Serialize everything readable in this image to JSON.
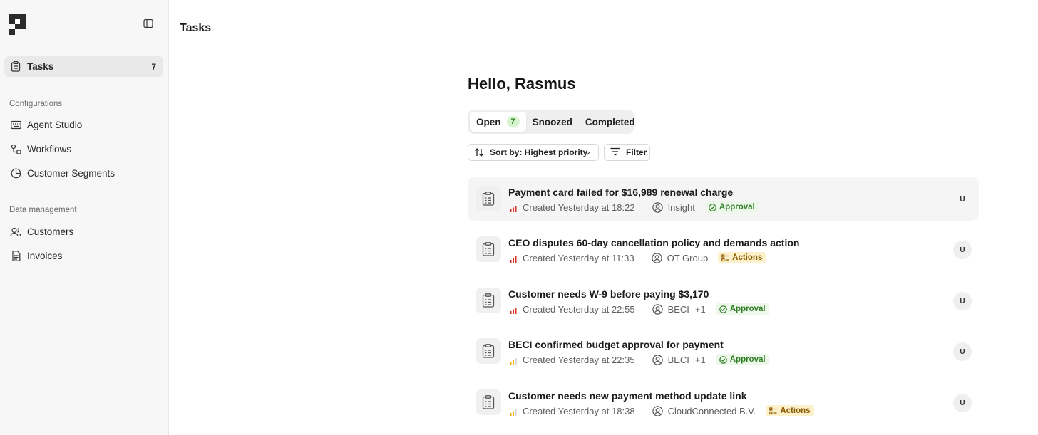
{
  "sidebar": {
    "nav": [
      {
        "label": "Tasks",
        "icon": "clipboard-icon",
        "count": "7",
        "active": true
      }
    ],
    "sections": [
      {
        "title": "Configurations",
        "items": [
          {
            "label": "Agent Studio",
            "icon": "keyboard-icon"
          },
          {
            "label": "Workflows",
            "icon": "workflow-icon"
          },
          {
            "label": "Customer Segments",
            "icon": "pie-chart-icon"
          }
        ]
      },
      {
        "title": "Data management",
        "items": [
          {
            "label": "Customers",
            "icon": "users-icon"
          },
          {
            "label": "Invoices",
            "icon": "file-text-icon"
          }
        ]
      }
    ]
  },
  "header": {
    "title": "Tasks"
  },
  "main": {
    "greeting": "Hello, Rasmus",
    "tabs": [
      {
        "label": "Open",
        "badge": "7",
        "active": true
      },
      {
        "label": "Snoozed"
      },
      {
        "label": "Completed"
      }
    ],
    "sort_label": "Sort by: Highest priority",
    "filter_label": "Filter",
    "tasks": [
      {
        "title": "Payment card failed for $16,989 renewal charge",
        "created": "Created Yesterday at 18:22",
        "customer": "Insight",
        "more": "",
        "tag": "Approval",
        "tag_type": "approval",
        "priority": "high",
        "assignee": "U"
      },
      {
        "title": "CEO disputes 60-day cancellation policy and demands action",
        "created": "Created Yesterday at 11:33",
        "customer": "OT Group",
        "more": "",
        "tag": "Actions",
        "tag_type": "actions",
        "priority": "high",
        "assignee": "U"
      },
      {
        "title": "Customer needs W-9 before paying $3,170",
        "created": "Created Yesterday at 22:55",
        "customer": "BECI",
        "more": "+1",
        "tag": "Approval",
        "tag_type": "approval",
        "priority": "high",
        "assignee": "U"
      },
      {
        "title": "BECI confirmed budget approval for payment",
        "created": "Created Yesterday at 22:35",
        "customer": "BECI",
        "more": "+1",
        "tag": "Approval",
        "tag_type": "approval",
        "priority": "medium",
        "assignee": "U"
      },
      {
        "title": "Customer needs new payment method update link",
        "created": "Created Yesterday at 18:38",
        "customer": "CloudConnected B.V.",
        "more": "",
        "tag": "Actions",
        "tag_type": "actions",
        "priority": "medium",
        "assignee": "U"
      }
    ]
  },
  "colors": {
    "priority_high": "#d93025",
    "priority_medium": "#f2a900",
    "approval": "#2f7d24",
    "actions": "#8a5a00",
    "badge_bg": "#d6f5cf"
  }
}
